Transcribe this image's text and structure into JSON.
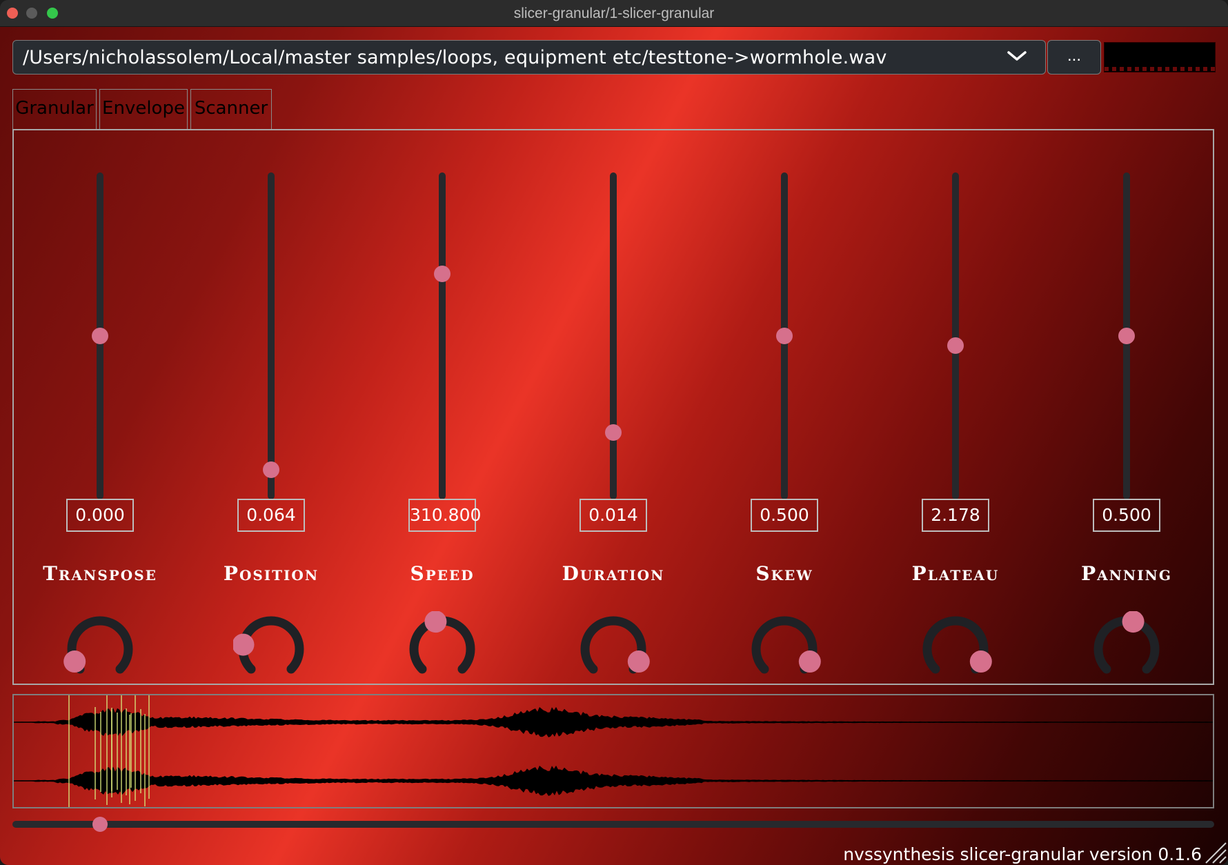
{
  "window": {
    "title": "slicer-granular/1-slicer-granular"
  },
  "file": {
    "path": "/Users/nicholassolem/Local/master samples/loops, equipment etc/testtone->wormhole.wav",
    "browse_label": "..."
  },
  "tabs": [
    {
      "label": "Granular",
      "active": true
    },
    {
      "label": "Envelope",
      "active": false
    },
    {
      "label": "Scanner",
      "active": false
    }
  ],
  "params": [
    {
      "label": "Transpose",
      "value": "0.000",
      "slider": 0.5,
      "knob": 0.0
    },
    {
      "label": "Position",
      "value": "0.064",
      "slider": 0.07,
      "knob": 0.2
    },
    {
      "label": "Speed",
      "value": "310.800",
      "slider": 0.7,
      "knob": 0.45
    },
    {
      "label": "Duration",
      "value": "0.014",
      "slider": 0.19,
      "knob": 1.0
    },
    {
      "label": "Skew",
      "value": "0.500",
      "slider": 0.5,
      "knob": 1.0
    },
    {
      "label": "Plateau",
      "value": "2.178",
      "slider": 0.47,
      "knob": 1.0
    },
    {
      "label": "Panning",
      "value": "0.500",
      "slider": 0.5,
      "knob": 0.55
    }
  ],
  "scan_position": 0.066,
  "footer": {
    "version": "nvssynthesis slicer-granular version 0.1.6"
  },
  "colors": {
    "accent": "#d6708c",
    "track": "#26282c",
    "grain": "#d8e47a"
  }
}
